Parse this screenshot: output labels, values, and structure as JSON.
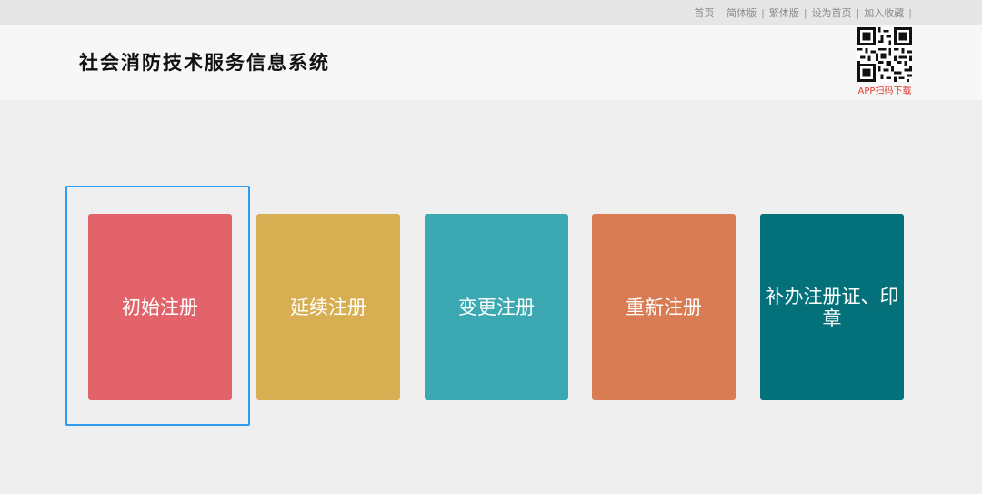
{
  "top_links": [
    {
      "label": "首页"
    },
    {
      "label": "简体版"
    },
    {
      "label": "繁体版"
    },
    {
      "label": "设为首页"
    },
    {
      "label": "加入收藏"
    }
  ],
  "header": {
    "title": "社会消防技术服务信息系统",
    "qr_caption": "APP扫码下载",
    "qr_icon": "qr-code-icon"
  },
  "tiles": [
    {
      "label": "初始注册",
      "color": "#e2646a",
      "selected": true
    },
    {
      "label": "延续注册",
      "color": "#d8ae52",
      "selected": false
    },
    {
      "label": "变更注册",
      "color": "#3ca8b2",
      "selected": false
    },
    {
      "label": "重新注册",
      "color": "#d97b53",
      "selected": false
    },
    {
      "label": "补办注册证、印章",
      "color": "#04707a",
      "selected": false
    }
  ],
  "colors": {
    "selection_border": "#2e9cf0",
    "qr_caption": "#e03c31",
    "topbar_bg": "#e6e6e6",
    "header_bg": "#f7f7f7",
    "page_bg": "#efefef"
  }
}
